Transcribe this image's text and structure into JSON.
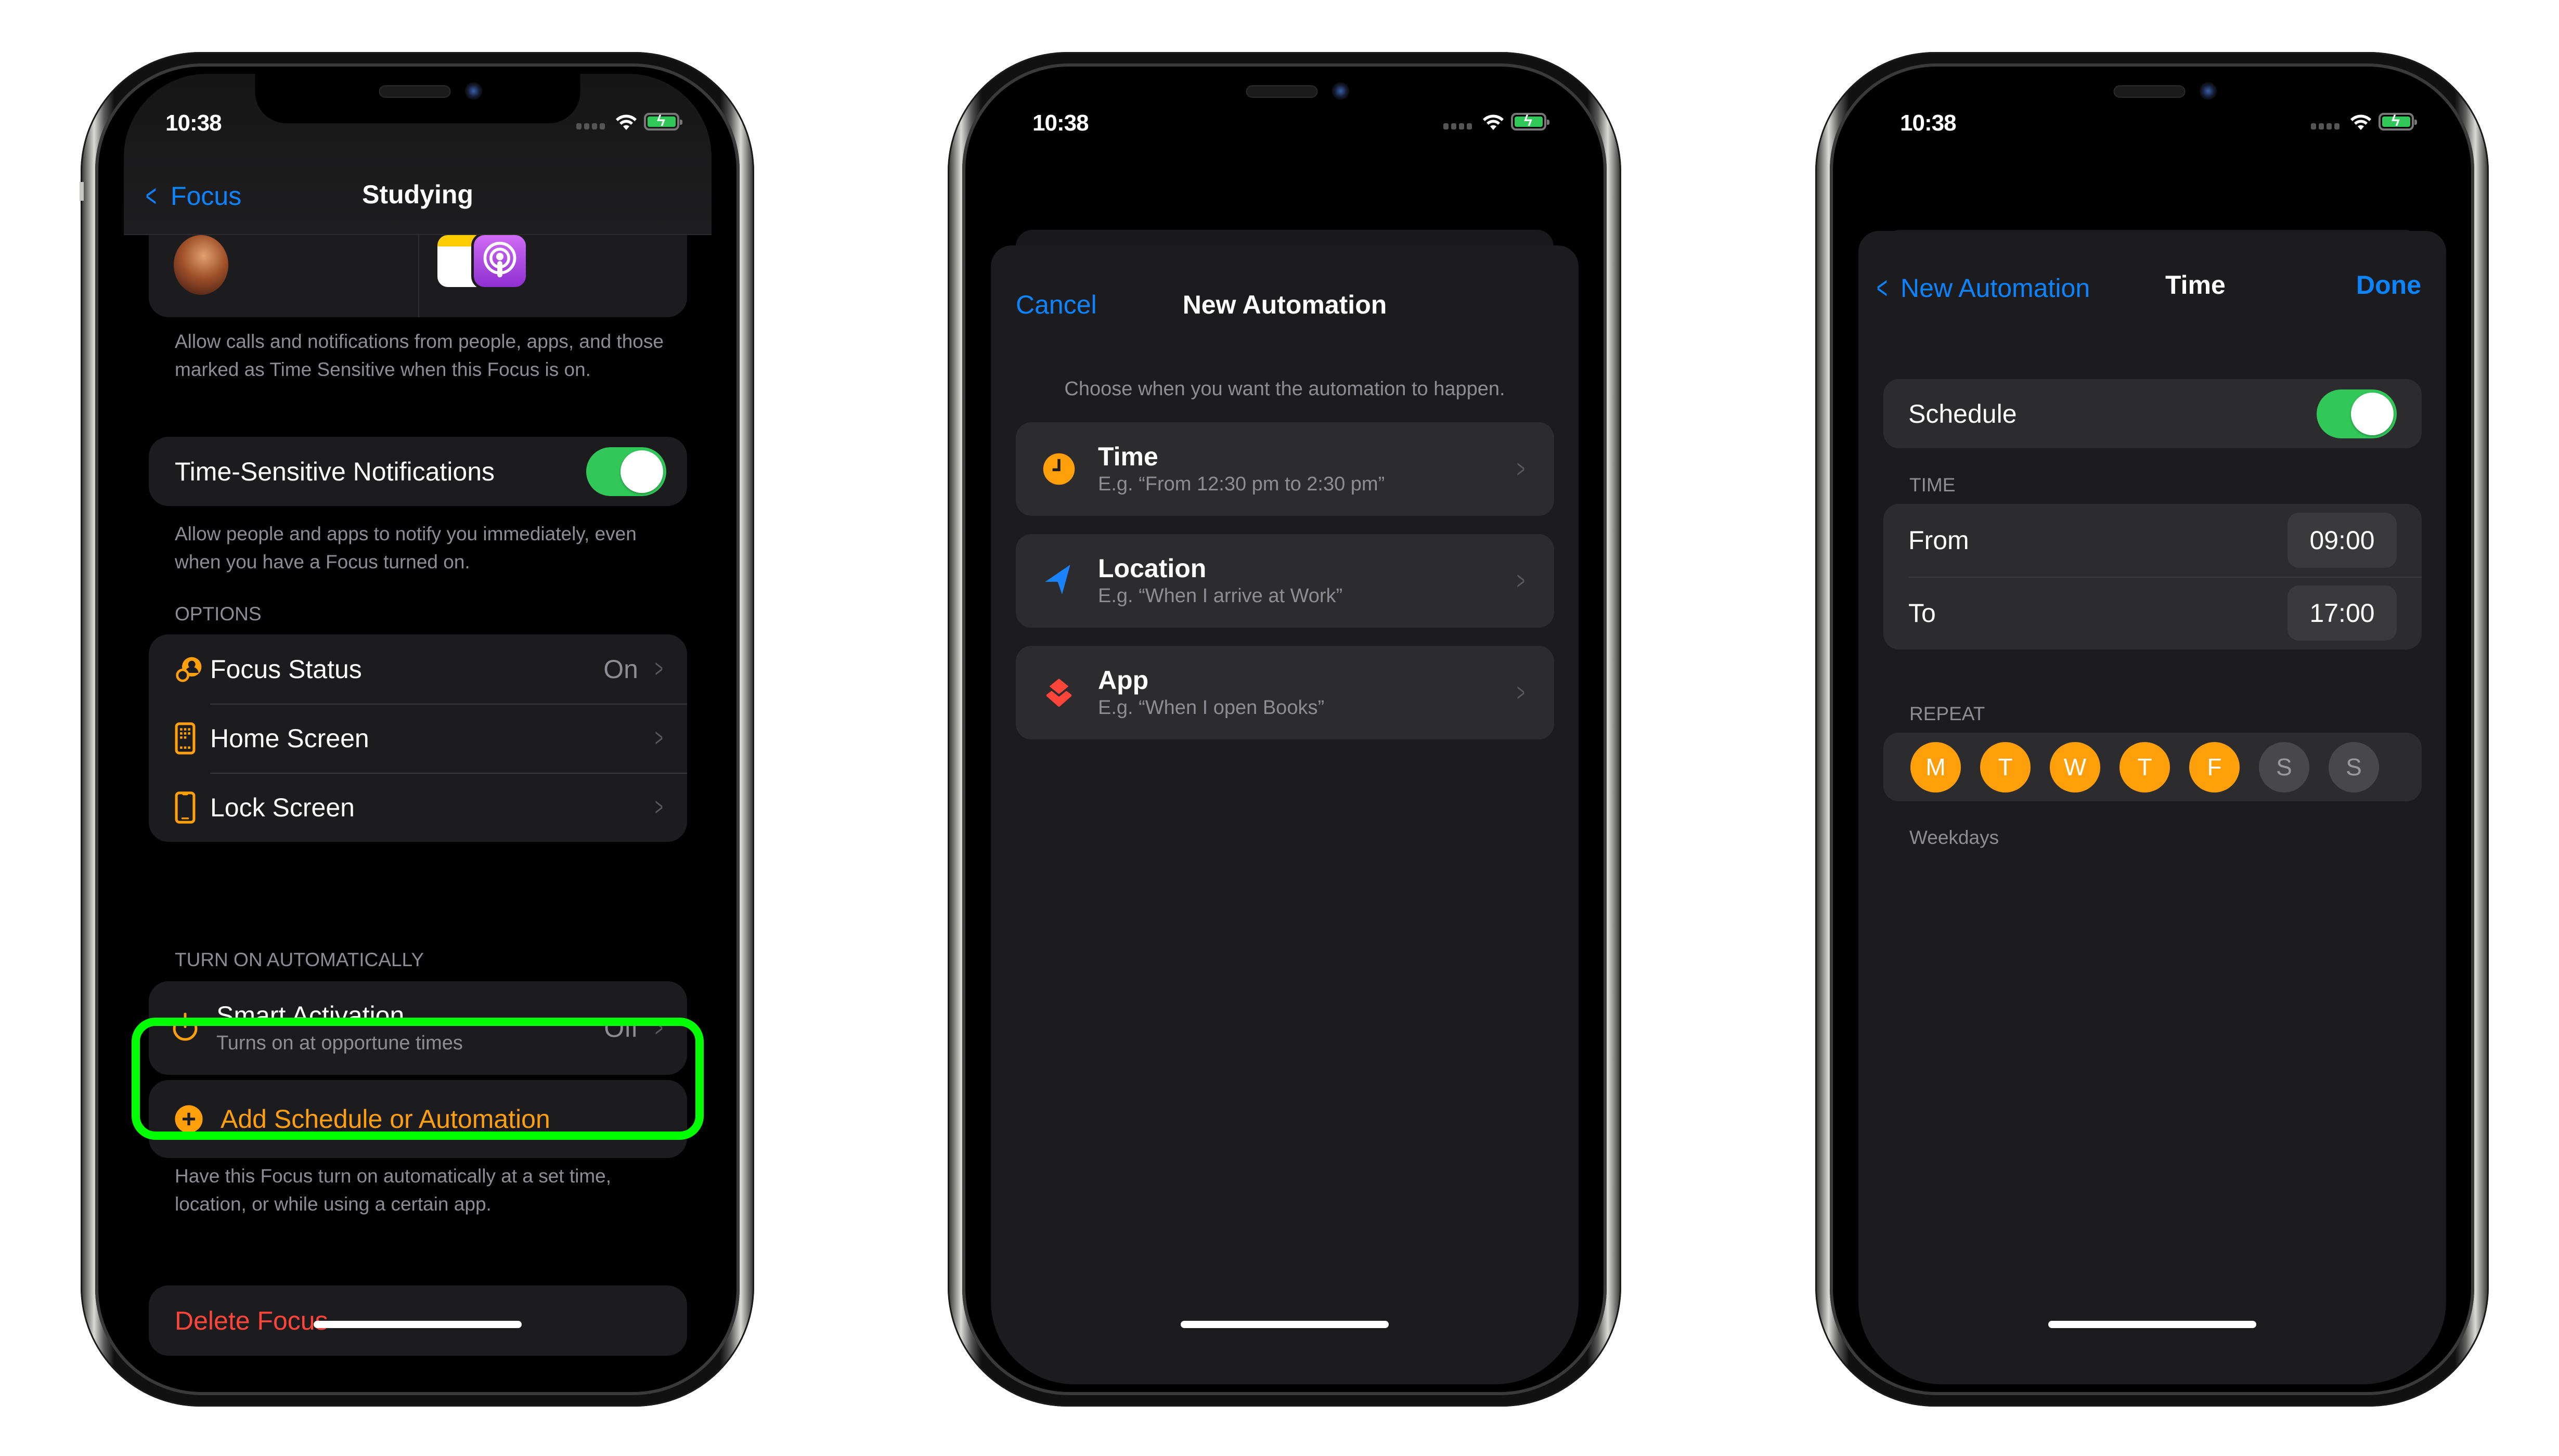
{
  "colors": {
    "accent_blue": "#0a84ff",
    "accent_orange": "#ff9f0a",
    "toggle_green": "#32c759",
    "destructive_red": "#ff453a",
    "highlight_green": "#00ff00",
    "location_blue": "#1a82fb"
  },
  "status_bar": {
    "time": "10:38",
    "wifi_icon": "wifi-icon",
    "battery_icon": "battery-charging-icon"
  },
  "screen1": {
    "nav": {
      "back_label": "Focus",
      "title": "Studying"
    },
    "allowed": {
      "people_icon": "contact-avatar",
      "apps_icons": [
        "notes-app-icon",
        "podcasts-app-icon"
      ],
      "footer": "Allow calls and notifications from people, apps, and those marked as Time Sensitive when this Focus is on."
    },
    "time_sensitive": {
      "label": "Time-Sensitive Notifications",
      "enabled": true,
      "footer": "Allow people and apps to notify you immediately, even when you have a Focus turned on."
    },
    "options": {
      "header": "OPTIONS",
      "items": [
        {
          "label": "Focus Status",
          "value": "On",
          "icon": "focus-status-icon"
        },
        {
          "label": "Home Screen",
          "value": "",
          "icon": "home-screen-icon"
        },
        {
          "label": "Lock Screen",
          "value": "",
          "icon": "lock-screen-icon"
        }
      ]
    },
    "automation": {
      "header": "TURN ON AUTOMATICALLY",
      "smart_activation": {
        "label": "Smart Activation",
        "sublabel": "Turns on at opportune times",
        "value": "Off",
        "icon": "power-icon"
      },
      "add_label": "Add Schedule or Automation",
      "footer": "Have this Focus turn on automatically at a set time, location, or while using a certain app."
    },
    "delete_label": "Delete Focus"
  },
  "screen2": {
    "nav": {
      "cancel_label": "Cancel",
      "title": "New Automation"
    },
    "hint": "Choose when you want the automation to happen.",
    "options": [
      {
        "title": "Time",
        "example": "E.g. “From 12:30 pm to 2:30 pm”",
        "icon": "clock-icon"
      },
      {
        "title": "Location",
        "example": "E.g. “When I arrive at Work”",
        "icon": "location-arrow-icon"
      },
      {
        "title": "App",
        "example": "E.g. “When I open Books”",
        "icon": "app-layers-icon"
      }
    ]
  },
  "screen3": {
    "nav": {
      "back_label": "New Automation",
      "title": "Time",
      "done_label": "Done"
    },
    "schedule": {
      "label": "Schedule",
      "enabled": true
    },
    "time_header": "TIME",
    "from": {
      "label": "From",
      "value": "09:00"
    },
    "to": {
      "label": "To",
      "value": "17:00"
    },
    "repeat_header": "REPEAT",
    "days": [
      {
        "label": "M",
        "selected": true
      },
      {
        "label": "T",
        "selected": true
      },
      {
        "label": "W",
        "selected": true
      },
      {
        "label": "T",
        "selected": true
      },
      {
        "label": "F",
        "selected": true
      },
      {
        "label": "S",
        "selected": false
      },
      {
        "label": "S",
        "selected": false
      }
    ],
    "repeat_summary": "Weekdays"
  }
}
